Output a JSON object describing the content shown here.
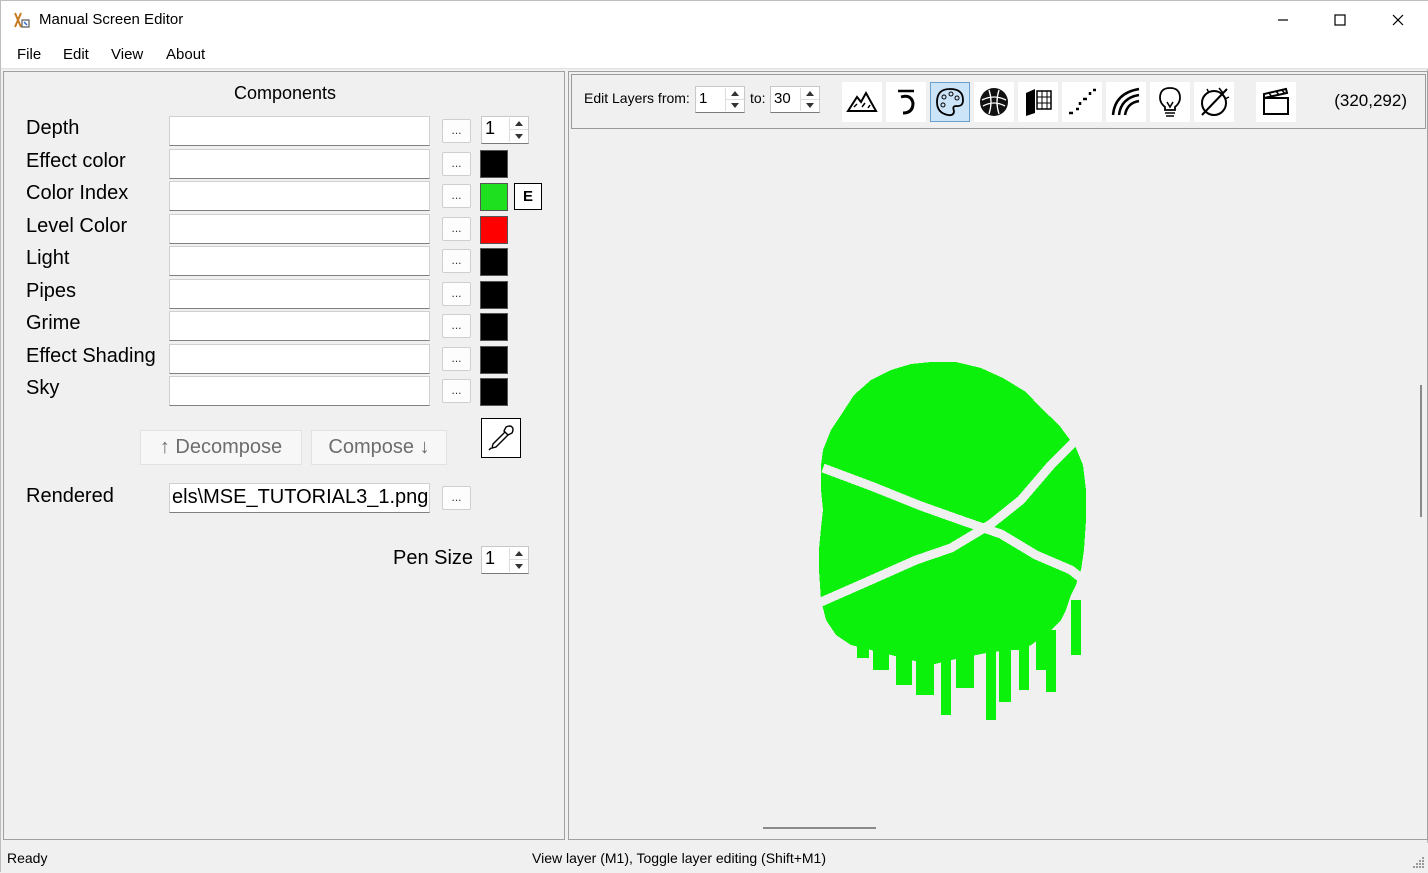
{
  "window": {
    "title": "Manual Screen Editor",
    "controls": {
      "minimize": "minimize",
      "maximize": "maximize",
      "close": "close"
    }
  },
  "menu": [
    "File",
    "Edit",
    "View",
    "About"
  ],
  "components": {
    "title": "Components",
    "rows": [
      {
        "label": "Depth",
        "value": "",
        "swatch": null
      },
      {
        "label": "Effect color",
        "value": "",
        "swatch": "#000000"
      },
      {
        "label": "Color Index",
        "value": "",
        "swatch": "#1ee01e"
      },
      {
        "label": "Level Color",
        "value": "",
        "swatch": "#ff0000"
      },
      {
        "label": "Light",
        "value": "",
        "swatch": "#000000"
      },
      {
        "label": "Pipes",
        "value": "",
        "swatch": "#000000"
      },
      {
        "label": "Grime",
        "value": "",
        "swatch": "#000000"
      },
      {
        "label": "Effect Shading",
        "value": "",
        "swatch": "#000000"
      },
      {
        "label": "Sky",
        "value": "",
        "swatch": "#000000"
      }
    ],
    "browse_label": "...",
    "depth_spinner_value": "1",
    "edit_button": "E",
    "decompose_label": "↑  Decompose",
    "compose_label": "Compose  ↓",
    "rendered_label": "Rendered",
    "rendered_value": "els\\MSE_TUTORIAL3_1.png",
    "pen_size_label": "Pen Size",
    "pen_size_value": "1"
  },
  "toolbar": {
    "edit_layers_from_label": "Edit Layers from:",
    "from_value": "1",
    "to_label": "to:",
    "to_value": "30",
    "tools": [
      {
        "name": "terrain-icon",
        "active": false
      },
      {
        "name": "undo-arc-icon",
        "active": false
      },
      {
        "name": "palette-icon",
        "active": true
      },
      {
        "name": "ball-icon",
        "active": false
      },
      {
        "name": "grid-cube-icon",
        "active": false
      },
      {
        "name": "dotted-path-icon",
        "active": false
      },
      {
        "name": "rainbow-icon",
        "active": false
      },
      {
        "name": "lightbulb-icon",
        "active": false
      },
      {
        "name": "cut-circle-icon",
        "active": false
      },
      {
        "name": "clapperboard-icon",
        "active": false
      }
    ],
    "coords": "(320,292)"
  },
  "canvas": {
    "shape_color": "#0cf10c"
  },
  "status": {
    "left": "Ready",
    "center": "View layer (M1), Toggle layer editing (Shift+M1)"
  }
}
